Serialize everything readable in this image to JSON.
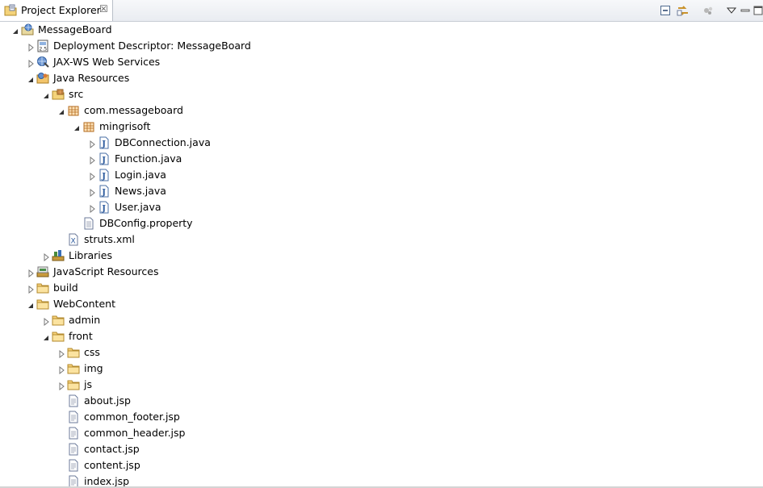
{
  "tab": {
    "title": "Project Explorer",
    "close_glyph": "☒"
  },
  "toolbar": {
    "collapse_icon": "collapse-all-icon",
    "link_icon": "link-with-editor-icon",
    "filter_icon": "filter-icon",
    "menu_icon": "view-menu-icon",
    "minimize_icon": "minimize-icon",
    "maximize_icon": "maximize-icon"
  },
  "tree": {
    "items": [
      {
        "label": "MessageBoard",
        "icon": "web-project-icon",
        "state": "expanded"
      },
      {
        "label": "Deployment Descriptor: MessageBoard",
        "icon": "deployment-descriptor-icon",
        "state": "collapsed"
      },
      {
        "label": "JAX-WS Web Services",
        "icon": "web-services-icon",
        "state": "collapsed"
      },
      {
        "label": "Java Resources",
        "icon": "java-resources-icon",
        "state": "expanded"
      },
      {
        "label": "src",
        "icon": "source-folder-icon",
        "state": "expanded"
      },
      {
        "label": "com.messageboard",
        "icon": "package-icon",
        "state": "expanded"
      },
      {
        "label": "mingrisoft",
        "icon": "package-icon",
        "state": "expanded"
      },
      {
        "label": "DBConnection.java",
        "icon": "java-file-icon",
        "state": "collapsed"
      },
      {
        "label": "Function.java",
        "icon": "java-file-icon",
        "state": "collapsed"
      },
      {
        "label": "Login.java",
        "icon": "java-file-icon",
        "state": "collapsed"
      },
      {
        "label": "News.java",
        "icon": "java-file-icon",
        "state": "collapsed"
      },
      {
        "label": "User.java",
        "icon": "java-file-icon",
        "state": "collapsed"
      },
      {
        "label": "DBConfig.property",
        "icon": "text-file-icon",
        "state": "leaf"
      },
      {
        "label": "struts.xml",
        "icon": "xml-file-icon",
        "state": "leaf"
      },
      {
        "label": "Libraries",
        "icon": "libraries-icon",
        "state": "collapsed"
      },
      {
        "label": "JavaScript Resources",
        "icon": "javascript-resources-icon",
        "state": "collapsed"
      },
      {
        "label": "build",
        "icon": "folder-icon",
        "state": "collapsed"
      },
      {
        "label": "WebContent",
        "icon": "folder-icon",
        "state": "expanded"
      },
      {
        "label": "admin",
        "icon": "folder-icon",
        "state": "collapsed"
      },
      {
        "label": "front",
        "icon": "folder-icon",
        "state": "expanded"
      },
      {
        "label": "css",
        "icon": "folder-icon",
        "state": "collapsed"
      },
      {
        "label": "img",
        "icon": "folder-icon",
        "state": "collapsed"
      },
      {
        "label": "js",
        "icon": "folder-icon",
        "state": "collapsed"
      },
      {
        "label": "about.jsp",
        "icon": "jsp-file-icon",
        "state": "leaf"
      },
      {
        "label": "common_footer.jsp",
        "icon": "jsp-file-icon",
        "state": "leaf"
      },
      {
        "label": "common_header.jsp",
        "icon": "jsp-file-icon",
        "state": "leaf"
      },
      {
        "label": "contact.jsp",
        "icon": "jsp-file-icon",
        "state": "leaf"
      },
      {
        "label": "content.jsp",
        "icon": "jsp-file-icon",
        "state": "leaf"
      },
      {
        "label": "index.jsp",
        "icon": "jsp-file-icon",
        "state": "leaf"
      }
    ]
  }
}
